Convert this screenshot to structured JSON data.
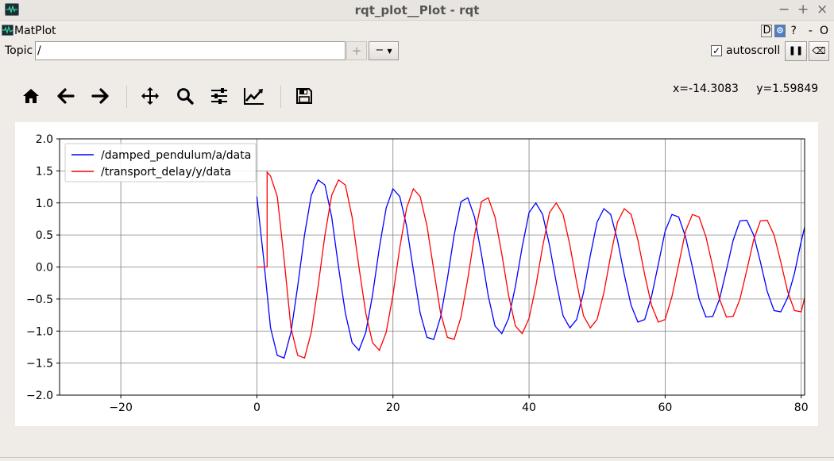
{
  "window": {
    "title": "rqt_plot__Plot - rqt",
    "controls": [
      "−",
      "+",
      "×"
    ]
  },
  "menubar": {
    "plugin_label": "MatPlot",
    "dock_buttons": [
      "D",
      "?",
      "-",
      "O"
    ]
  },
  "topic_bar": {
    "label": "Topic",
    "input_value": "/",
    "add_label": "+",
    "remove_label": "−",
    "autoscroll_label": "autoscroll",
    "autoscroll_checked": true,
    "autoscroll_mark": "✓",
    "pause_label": "❚❚",
    "clear_label": "⌫"
  },
  "toolbar": {
    "icons": [
      "home-icon",
      "back-icon",
      "forward-icon",
      "pan-icon",
      "zoom-icon",
      "subplots-icon",
      "edit-axis-icon",
      "save-icon"
    ]
  },
  "cursor": {
    "x_text": "x=-14.3083",
    "y_text": "y=1.59849"
  },
  "chart_data": {
    "type": "line",
    "title": "",
    "xlabel": "",
    "ylabel": "",
    "xlim": [
      -29,
      80.5
    ],
    "ylim": [
      -2.0,
      2.0
    ],
    "xticks": [
      -20,
      0,
      20,
      40,
      60,
      80
    ],
    "xtick_labels": [
      "−20",
      "0",
      "20",
      "40",
      "60",
      "80"
    ],
    "yticks": [
      -2.0,
      -1.5,
      -1.0,
      -0.5,
      0.0,
      0.5,
      1.0,
      1.5,
      2.0
    ],
    "ytick_labels": [
      "−2.0",
      "−1.5",
      "−1.0",
      "−0.5",
      "0.0",
      "0.5",
      "1.0",
      "1.5",
      "2.0"
    ],
    "grid": true,
    "legend_position": "top-left",
    "series": [
      {
        "name": "/damped_pendulum/a/data",
        "color": "#0000ff",
        "x": [
          0,
          1,
          2,
          3,
          4,
          5,
          6,
          7,
          8,
          9,
          10,
          11,
          12,
          13,
          14,
          15,
          16,
          17,
          18,
          19,
          20,
          21,
          22,
          23,
          24,
          25,
          26,
          27,
          28,
          29,
          30,
          31,
          32,
          33,
          34,
          35,
          36,
          37,
          38,
          39,
          40,
          41,
          42,
          43,
          44,
          45,
          46,
          47,
          48,
          49,
          50,
          51,
          52,
          53,
          54,
          55,
          56,
          57,
          58,
          59,
          60,
          61,
          62,
          63,
          64,
          65,
          66,
          67,
          68,
          69,
          70,
          71,
          72,
          73,
          74,
          75,
          76,
          77,
          78,
          79,
          80,
          80.5
        ],
        "y": [
          1.1,
          0.12,
          -0.95,
          -1.38,
          -1.42,
          -1.02,
          -0.3,
          0.5,
          1.12,
          1.36,
          1.28,
          0.78,
          0.0,
          -0.72,
          -1.18,
          -1.3,
          -1.02,
          -0.44,
          0.3,
          0.92,
          1.22,
          1.1,
          0.64,
          -0.05,
          -0.72,
          -1.1,
          -1.13,
          -0.78,
          -0.18,
          0.5,
          1.02,
          1.08,
          0.78,
          0.2,
          -0.45,
          -0.92,
          -1.04,
          -0.8,
          -0.3,
          0.32,
          0.85,
          1.0,
          0.82,
          0.34,
          -0.24,
          -0.76,
          -0.95,
          -0.82,
          -0.4,
          0.18,
          0.7,
          0.91,
          0.82,
          0.42,
          -0.12,
          -0.6,
          -0.86,
          -0.82,
          -0.46,
          0.04,
          0.56,
          0.82,
          0.78,
          0.47,
          0.0,
          -0.5,
          -0.78,
          -0.77,
          -0.5,
          -0.05,
          0.42,
          0.72,
          0.73,
          0.5,
          0.08,
          -0.38,
          -0.68,
          -0.7,
          -0.48,
          -0.1,
          0.4,
          0.62
        ]
      },
      {
        "name": "/transport_delay/y/data",
        "color": "#ff0000",
        "x": [
          0,
          1.5,
          1.5,
          2,
          3,
          4,
          5,
          6,
          7,
          8,
          9,
          10,
          11,
          12,
          13,
          14,
          15,
          16,
          17,
          18,
          19,
          20,
          21,
          22,
          23,
          24,
          25,
          26,
          27,
          28,
          29,
          30,
          31,
          32,
          33,
          34,
          35,
          36,
          37,
          38,
          39,
          40,
          41,
          42,
          43,
          44,
          45,
          46,
          47,
          48,
          49,
          50,
          51,
          52,
          53,
          54,
          55,
          56,
          57,
          58,
          59,
          60,
          61,
          62,
          63,
          64,
          65,
          66,
          67,
          68,
          69,
          70,
          71,
          72,
          73,
          74,
          75,
          76,
          77,
          78,
          79,
          80,
          80.5
        ],
        "y": [
          0.0,
          0.0,
          1.48,
          1.42,
          1.1,
          0.12,
          -0.95,
          -1.38,
          -1.42,
          -1.02,
          -0.3,
          0.5,
          1.12,
          1.36,
          1.28,
          0.78,
          0.0,
          -0.72,
          -1.18,
          -1.3,
          -1.02,
          -0.44,
          0.3,
          0.92,
          1.22,
          1.1,
          0.64,
          -0.05,
          -0.72,
          -1.1,
          -1.13,
          -0.78,
          -0.18,
          0.5,
          1.02,
          1.08,
          0.78,
          0.2,
          -0.45,
          -0.92,
          -1.04,
          -0.8,
          -0.3,
          0.32,
          0.85,
          1.0,
          0.82,
          0.34,
          -0.24,
          -0.76,
          -0.95,
          -0.82,
          -0.4,
          0.18,
          0.7,
          0.91,
          0.82,
          0.42,
          -0.12,
          -0.6,
          -0.86,
          -0.82,
          -0.46,
          0.04,
          0.56,
          0.82,
          0.78,
          0.47,
          0.0,
          -0.5,
          -0.78,
          -0.77,
          -0.5,
          -0.05,
          0.42,
          0.72,
          0.73,
          0.5,
          0.08,
          -0.38,
          -0.68,
          -0.7,
          -0.48
        ]
      }
    ]
  }
}
